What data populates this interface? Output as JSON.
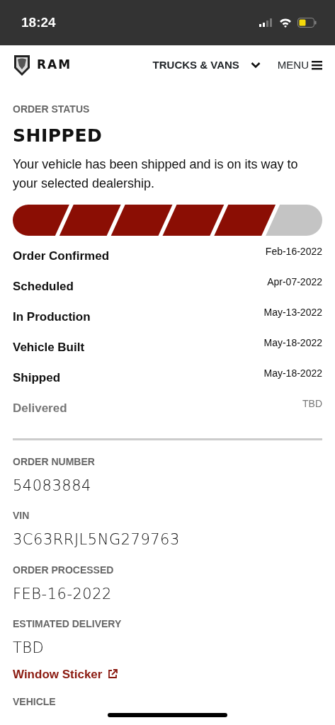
{
  "status_bar": {
    "time": "18:24"
  },
  "header": {
    "nav_label": "TRUCKS & VANS",
    "menu_label": "MENU",
    "brand": "RAM"
  },
  "order_status": {
    "label": "ORDER STATUS",
    "title": "SHIPPED",
    "description": "Your vehicle has been shipped and is on its way to your selected dealership."
  },
  "steps": [
    {
      "name": "Order Confirmed",
      "date": "Feb-16-2022",
      "completed": true
    },
    {
      "name": "Scheduled",
      "date": "Apr-07-2022",
      "completed": true
    },
    {
      "name": "In Production",
      "date": "May-13-2022",
      "completed": true
    },
    {
      "name": "Vehicle Built",
      "date": "May-18-2022",
      "completed": true
    },
    {
      "name": "Shipped",
      "date": "May-18-2022",
      "completed": true
    },
    {
      "name": "Delivered",
      "date": "TBD",
      "completed": false
    }
  ],
  "details": [
    {
      "label": "ORDER NUMBER",
      "value": "54083884"
    },
    {
      "label": "VIN",
      "value": "3C63RRJL5NG279763"
    },
    {
      "label": "ORDER PROCESSED",
      "value": "FEB-16-2022"
    },
    {
      "label": "ESTIMATED DELIVERY",
      "value": "TBD"
    }
  ],
  "link": "Window Sticker",
  "next_section_label": "VEHICLE"
}
